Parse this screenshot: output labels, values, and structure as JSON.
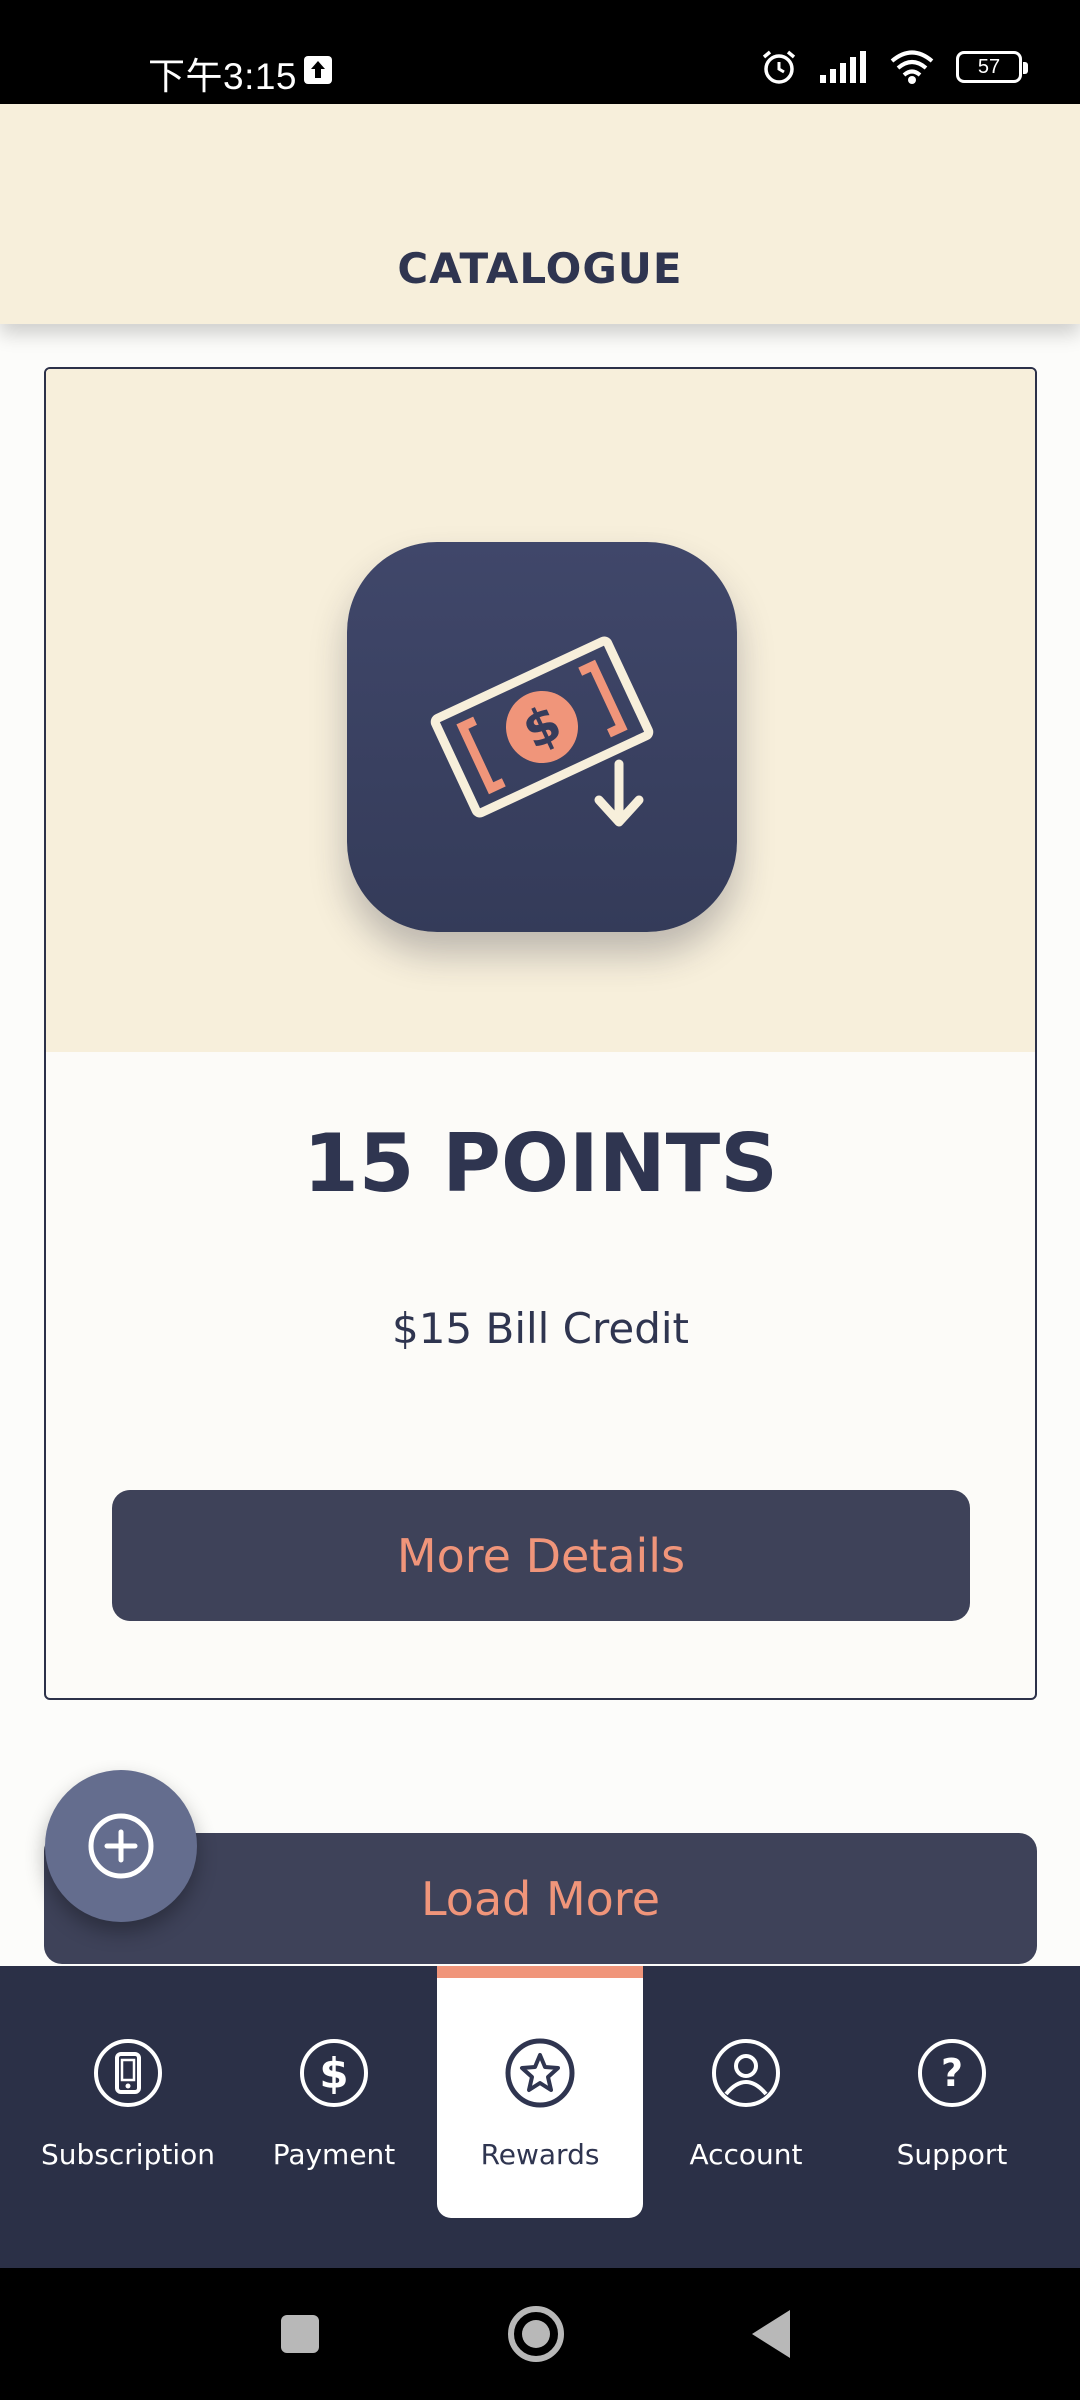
{
  "status_bar": {
    "time": "下午3:15",
    "battery": "57",
    "icons": [
      "upload-icon",
      "alarm-icon",
      "signal-icon",
      "wifi-icon",
      "battery-icon"
    ]
  },
  "header": {
    "title": "CATALOGUE"
  },
  "card": {
    "icon": "money-bill-download-icon",
    "points": "15 POINTS",
    "description": "$15 Bill Credit",
    "details_label": "More Details"
  },
  "load_more_label": "Load More",
  "fab": {
    "icon": "plus-circle-icon"
  },
  "bottom_nav": {
    "active": "Rewards",
    "items": [
      {
        "label": "Subscription",
        "icon": "phone-icon"
      },
      {
        "label": "Payment",
        "icon": "dollar-circle-icon"
      },
      {
        "label": "Rewards",
        "icon": "star-circle-icon"
      },
      {
        "label": "Account",
        "icon": "user-circle-icon"
      },
      {
        "label": "Support",
        "icon": "question-circle-icon"
      }
    ]
  },
  "colors": {
    "header_bg": "#f7efdb",
    "navy": "#2b3047",
    "button_bg": "#3e4259",
    "accent": "#f0957a",
    "fab_bg": "#646d8e"
  }
}
